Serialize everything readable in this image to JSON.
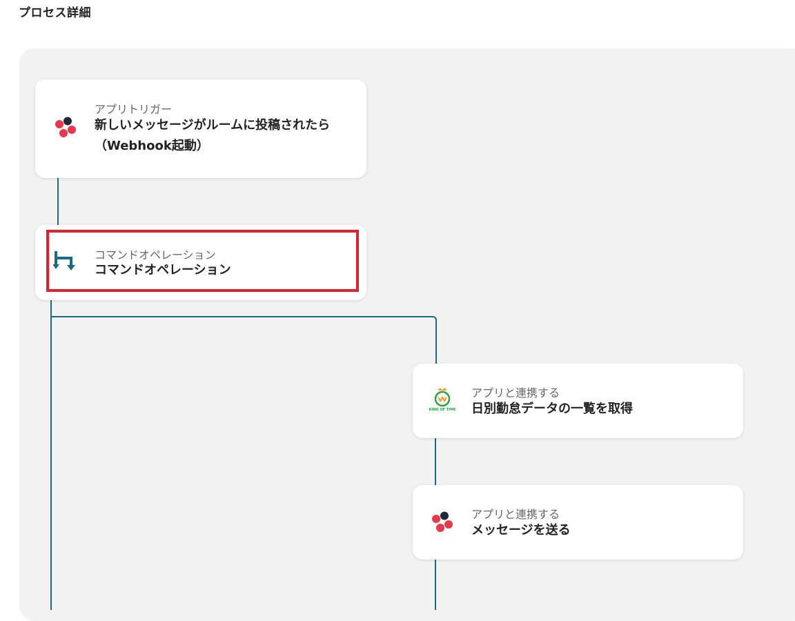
{
  "page": {
    "title": "プロセス詳細"
  },
  "flow": {
    "steps": [
      {
        "label": "アプリトリガー",
        "title_line1": "新しいメッセージがルームに投稿されたら",
        "title_line2": "（Webhook起動）",
        "icon": "chatwork-icon"
      },
      {
        "label": "コマンドオペレーション",
        "title_line1": "コマンドオペレーション",
        "icon": "branch-command-icon",
        "highlighted": true
      },
      {
        "label": "アプリと連携する",
        "title_line1": "日別勤怠データの一覧を取得",
        "icon": "king-of-time-icon",
        "icon_text": "KING OF TIME"
      },
      {
        "label": "アプリと連携する",
        "title_line1": "メッセージを送る",
        "icon": "chatwork-icon"
      }
    ]
  },
  "colors": {
    "connector": "#1a6b82",
    "highlight": "#e0202c",
    "chatwork_red": "#e8384a",
    "chatwork_dark": "#1e2a3a",
    "kot_green": "#2ea043",
    "kot_orange": "#f29a1f"
  }
}
